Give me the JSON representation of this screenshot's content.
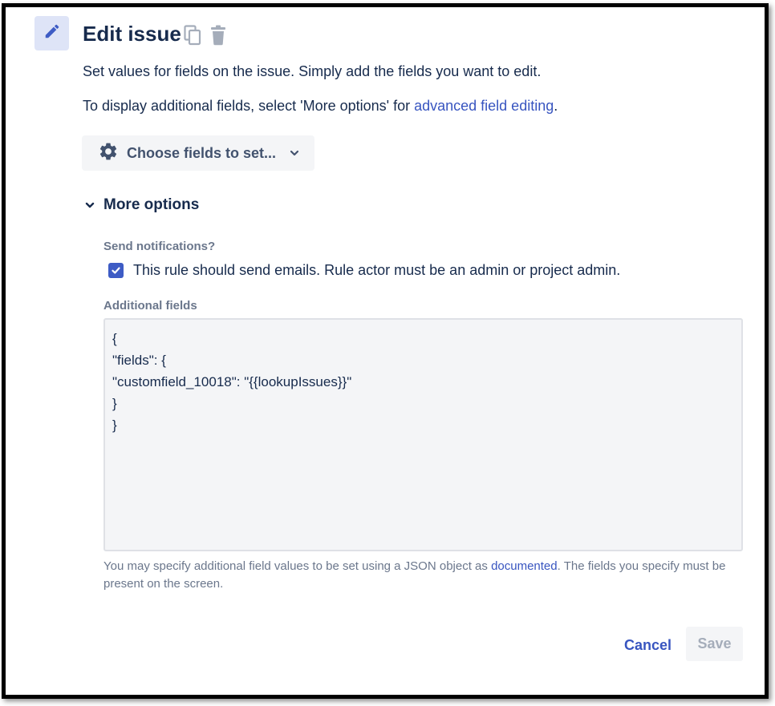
{
  "header": {
    "title": "Edit issue",
    "icons": [
      "pencil-icon",
      "copy-icon",
      "trash-icon"
    ]
  },
  "description": {
    "line1": "Set values for fields on the issue. Simply add the fields you want to edit.",
    "line2_prefix": "To display additional fields, select 'More options' for ",
    "line2_link": "advanced field editing",
    "line2_suffix": "."
  },
  "choose_fields": {
    "label": "Choose fields to set...",
    "icon": "gear-icon",
    "chevron": "chevron-down-icon"
  },
  "more_options": {
    "label": "More options",
    "expanded": true
  },
  "notifications": {
    "label": "Send notifications?",
    "checkbox_text": "This rule should send emails. Rule actor must be an admin or project admin.",
    "checked": true
  },
  "additional_fields": {
    "label": "Additional fields",
    "value": "{\n\"fields\": {\n\"customfield_10018\": \"{{lookupIssues}}\"\n}\n}",
    "help_prefix": "You may specify additional field values to be set using a JSON object as ",
    "help_link": "documented",
    "help_suffix": ". The fields you specify must be present on the screen."
  },
  "actions": {
    "cancel_label": "Cancel",
    "save_label": "Save"
  },
  "colors": {
    "accent": "#3855C0",
    "text": "#172B4D",
    "subtle": "#6B778C",
    "checkbox": "#3E5CC5"
  }
}
